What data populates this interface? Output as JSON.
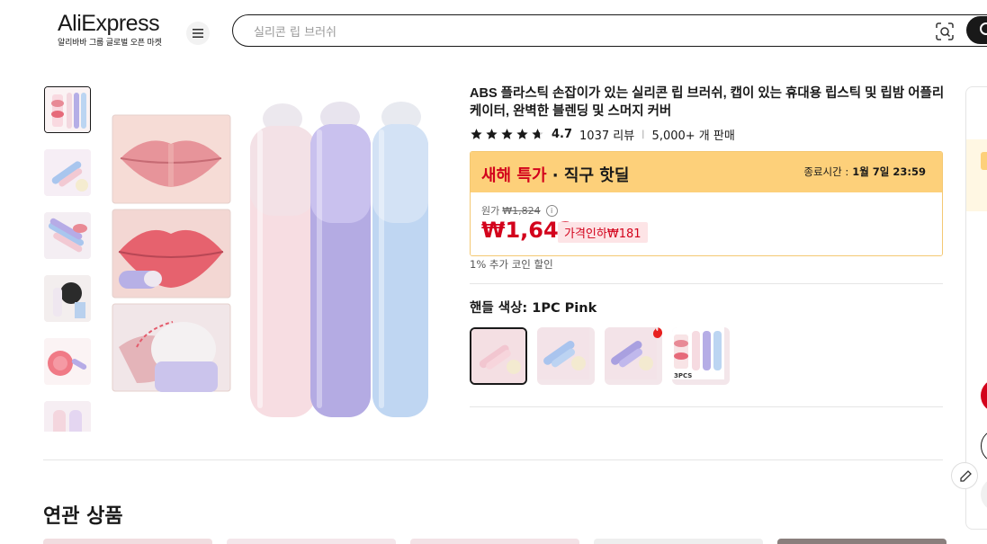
{
  "header": {
    "logo_text": "AliExpress",
    "logo_sub": "알리바바 그룹 글로벌 오픈 마켓",
    "search_placeholder": "실리콘 립 브러쉬"
  },
  "product": {
    "title": "ABS 플라스틱 손잡이가 있는 실리콘 립 브러쉬, 캡이 있는 휴대용 립스틱 및 립밤 어플리케이터, 완벽한 블렌딩 및 스머지 커버",
    "rating": "4.7",
    "reviews": "1037 리뷰",
    "sold": "5,000+ 개 판매",
    "star_count": 5
  },
  "deal": {
    "title_highlight": "새해 특가",
    "title_rest": " · 직구 핫딜",
    "end_label": "종료시간 :",
    "end_time": "1월 7일 23:59",
    "orig_label": "원가",
    "orig_price": "₩1,824",
    "price": "₩1,643",
    "discount": "가격인하₩181",
    "coin_note": "1% 추가 코인 할인"
  },
  "variant": {
    "label": "핸들 색상: 1PC Pink"
  },
  "related": {
    "title": "연관 상품"
  },
  "colors": {
    "accent_red": "#d3031c",
    "deal_yellow": "#fdd07a",
    "brand_orange": "#ff5f00"
  }
}
